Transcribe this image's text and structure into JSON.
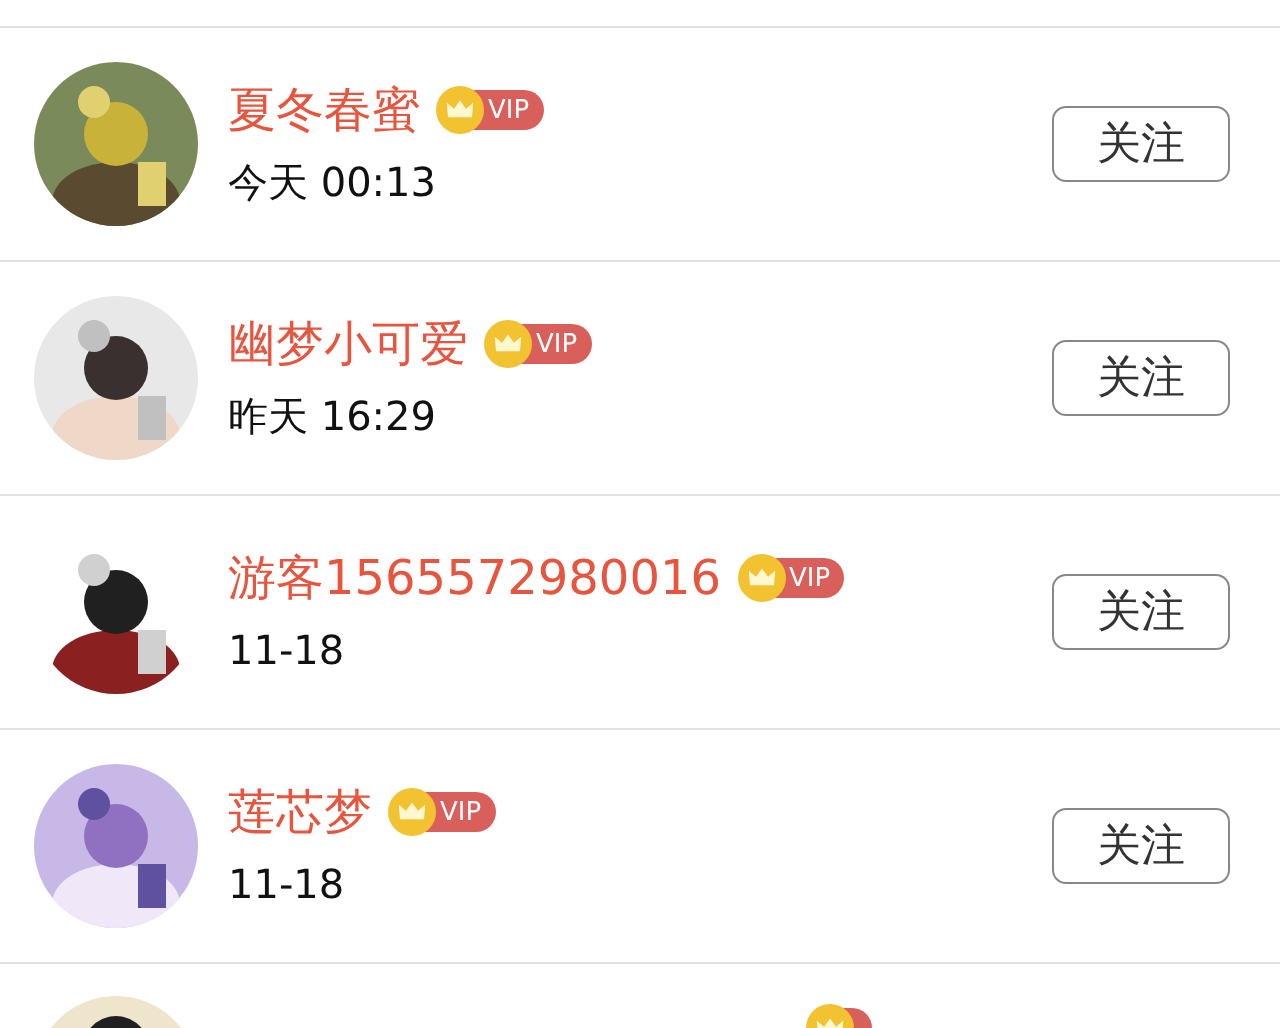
{
  "rows": [
    {
      "name": "夏冬春蜜",
      "vip": true,
      "badge": "VIP",
      "time": "今天 00:13",
      "button": "关注"
    },
    {
      "name": "幽梦小可爱",
      "vip": true,
      "badge": "VIP",
      "time": "昨天 16:29",
      "button": "关注"
    },
    {
      "name": "游客1565572980016",
      "vip": true,
      "badge": "VIP",
      "time": "11-18",
      "button": "关注"
    },
    {
      "name": "莲芯梦",
      "vip": true,
      "badge": "VIP",
      "time": "11-18",
      "button": "关注"
    }
  ],
  "partial_row": {
    "vip": true
  }
}
